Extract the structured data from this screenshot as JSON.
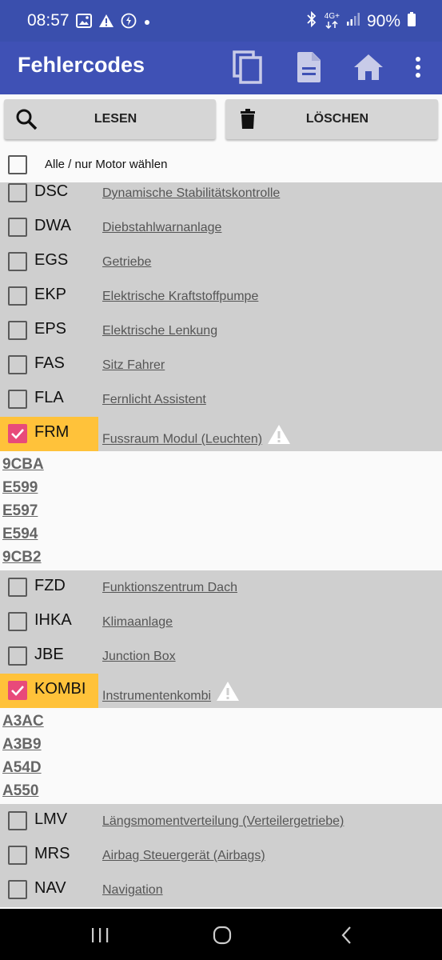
{
  "status_bar": {
    "time": "08:57",
    "battery": "90%",
    "network": "4G+",
    "icons": [
      "image-icon",
      "warning-icon",
      "shazam-icon",
      "dot-icon",
      "bluetooth-icon",
      "network-icon",
      "signal-icon",
      "battery-icon"
    ]
  },
  "app_bar": {
    "title": "Fehlercodes",
    "actions": [
      "copy-icon",
      "document-icon",
      "home-icon",
      "more-vert-icon"
    ]
  },
  "toolbar": {
    "read_label": "LESEN",
    "delete_label": "LÖSCHEN"
  },
  "select_all": {
    "label": "Alle / nur Motor wählen",
    "checked": false
  },
  "modules": [
    {
      "code": "DSC",
      "name": "Dynamische Stabilitätskontrolle",
      "checked": false,
      "warning": false,
      "errors": []
    },
    {
      "code": "DWA",
      "name": "Diebstahlwarnanlage",
      "checked": false,
      "warning": false,
      "errors": []
    },
    {
      "code": "EGS",
      "name": "Getriebe",
      "checked": false,
      "warning": false,
      "errors": []
    },
    {
      "code": "EKP",
      "name": "Elektrische Kraftstoffpumpe",
      "checked": false,
      "warning": false,
      "errors": []
    },
    {
      "code": "EPS",
      "name": "Elektrische Lenkung",
      "checked": false,
      "warning": false,
      "errors": []
    },
    {
      "code": "FAS",
      "name": "Sitz Fahrer",
      "checked": false,
      "warning": false,
      "errors": []
    },
    {
      "code": "FLA",
      "name": "Fernlicht Assistent",
      "checked": false,
      "warning": false,
      "errors": []
    },
    {
      "code": "FRM",
      "name": "Fussraum Modul (Leuchten)",
      "checked": true,
      "warning": true,
      "errors": [
        "9CBA",
        "E599",
        "E597",
        "E594",
        "9CB2"
      ]
    },
    {
      "code": "FZD",
      "name": "Funktionszentrum Dach",
      "checked": false,
      "warning": false,
      "errors": []
    },
    {
      "code": "IHKA",
      "name": "Klimaanlage",
      "checked": false,
      "warning": false,
      "errors": []
    },
    {
      "code": "JBE",
      "name": "Junction Box",
      "checked": false,
      "warning": false,
      "errors": []
    },
    {
      "code": "KOMBI",
      "name": "Instrumentenkombi",
      "checked": true,
      "warning": true,
      "errors": [
        "A3AC",
        "A3B9",
        "A54D",
        "A550"
      ]
    },
    {
      "code": "LMV",
      "name": "Längsmomentverteilung (Verteilergetriebe)",
      "checked": false,
      "warning": false,
      "errors": []
    },
    {
      "code": "MRS",
      "name": "Airbag Steuergerät (Airbags)",
      "checked": false,
      "warning": false,
      "errors": []
    },
    {
      "code": "NAV",
      "name": "Navigation",
      "checked": false,
      "warning": false,
      "errors": []
    }
  ],
  "nav_bar": {
    "buttons": [
      "recents-icon",
      "home-circle-icon",
      "back-icon"
    ]
  },
  "colors": {
    "status_bar": "#3a4fad",
    "app_bar": "#3f51b5",
    "row_bg": "#cfcfcf",
    "highlight": "#ffc23a",
    "checkbox_checked": "#e84a7a"
  }
}
